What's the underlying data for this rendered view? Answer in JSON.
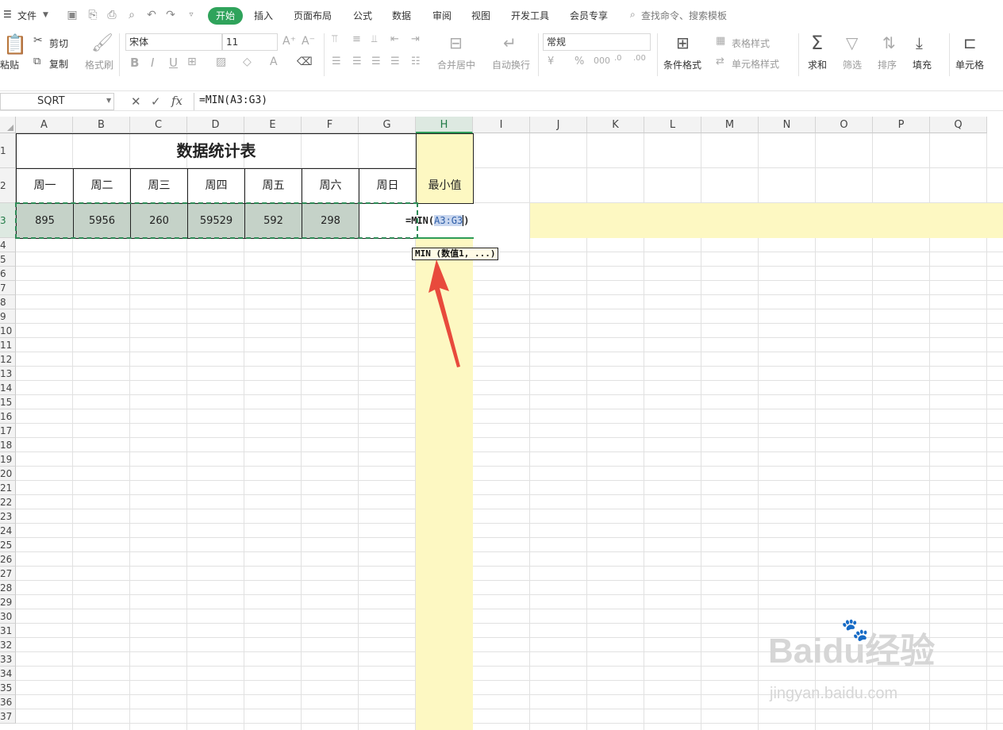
{
  "menubar": {
    "file_label": "文件",
    "tabs": [
      "开始",
      "插入",
      "页面布局",
      "公式",
      "数据",
      "审阅",
      "视图",
      "开发工具",
      "会员专享"
    ],
    "search_placeholder": "查找命令、搜索模板"
  },
  "ribbon": {
    "paste": "粘贴",
    "cut": "剪切",
    "copy": "复制",
    "format_painter": "格式刷",
    "font_name": "宋体",
    "font_size": "11",
    "merge_center": "合并居中",
    "wrap_text": "自动换行",
    "number_format": "常规",
    "conditional_format": "条件格式",
    "table_style": "表格样式",
    "cell_style": "单元格样式",
    "sum": "求和",
    "filter": "筛选",
    "sort": "排序",
    "fill": "填充",
    "cell": "单元格"
  },
  "formula_bar": {
    "name_box": "SQRT",
    "fx": "fx",
    "formula": "=MIN(A3:G3)"
  },
  "sheet": {
    "columns": [
      "A",
      "B",
      "C",
      "D",
      "E",
      "F",
      "G",
      "H",
      "I",
      "J",
      "K",
      "L",
      "M",
      "N",
      "O",
      "P",
      "Q"
    ],
    "selected_column": "H",
    "rows": [
      "1",
      "2",
      "3",
      "4",
      "5",
      "6",
      "7",
      "8",
      "9",
      "10",
      "11",
      "12",
      "13",
      "14",
      "15",
      "16",
      "17",
      "18",
      "19",
      "20",
      "21",
      "22",
      "23",
      "24",
      "25",
      "26",
      "27",
      "28",
      "29",
      "30",
      "31",
      "32",
      "33",
      "34",
      "35",
      "36",
      "37"
    ],
    "title": "数据统计表",
    "headers": [
      "周一",
      "周二",
      "周三",
      "周四",
      "周五",
      "周六",
      "周日",
      "最小值"
    ],
    "values": [
      "895",
      "5956",
      "260",
      "59529",
      "592",
      "298"
    ],
    "editing_prefix": "=MIN(",
    "editing_ref": "A3:G3",
    "editing_suffix": ")",
    "tooltip": "MIN (数值1, ...)"
  },
  "watermark": {
    "brand": "Baidu经验",
    "url": "jingyan.baidu.com"
  },
  "colors": {
    "accent_green": "#2fa35b",
    "selection_fill": "#c5d2c8",
    "column_highlight": "#fdf8c2",
    "arrow": "#e84a3c"
  }
}
